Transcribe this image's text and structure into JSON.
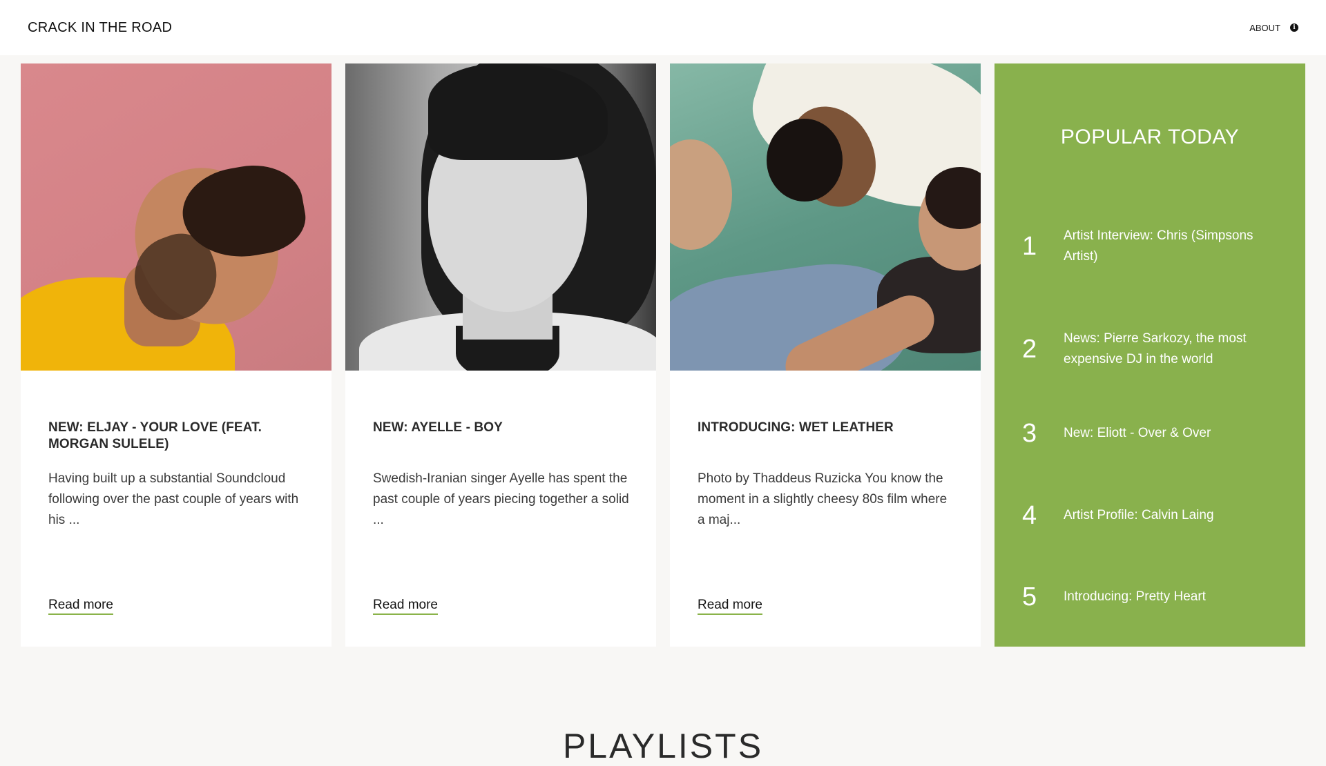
{
  "header": {
    "site_title": "CRACK IN THE ROAD",
    "about_label": "ABOUT",
    "about_icon": "info-icon"
  },
  "cards": [
    {
      "title": "NEW: ELJAY - YOUR LOVE (FEAT. MORGAN SULELE)",
      "excerpt": "Having built up a substantial Soundcloud following over the past couple of years with his ...",
      "read_more": "Read more"
    },
    {
      "title": "NEW: AYELLE - BOY",
      "excerpt": "Swedish-Iranian singer Ayelle has spent the past couple of years piecing together a solid ...",
      "read_more": "Read more"
    },
    {
      "title": "INTRODUCING: WET LEATHER",
      "excerpt": "Photo by Thaddeus Ruzicka You know the moment in a slightly cheesy 80s film where a maj...",
      "read_more": "Read more"
    }
  ],
  "popular": {
    "title": "POPULAR TODAY",
    "items": [
      {
        "rank": "1",
        "label": "Artist Interview: Chris (Simpsons Artist)"
      },
      {
        "rank": "2",
        "label": "News: Pierre Sarkozy, the most expensive DJ in the world"
      },
      {
        "rank": "3",
        "label": "New: Eliott - Over & Over"
      },
      {
        "rank": "4",
        "label": "Artist Profile: Calvin Laing"
      },
      {
        "rank": "5",
        "label": "Introducing: Pretty Heart"
      }
    ],
    "background_color": "#89b14d"
  },
  "section_heading": "PLAYLISTS",
  "colors": {
    "accent": "#89b14d",
    "underline": "#8ab34a",
    "page_bg": "#f8f7f5"
  }
}
